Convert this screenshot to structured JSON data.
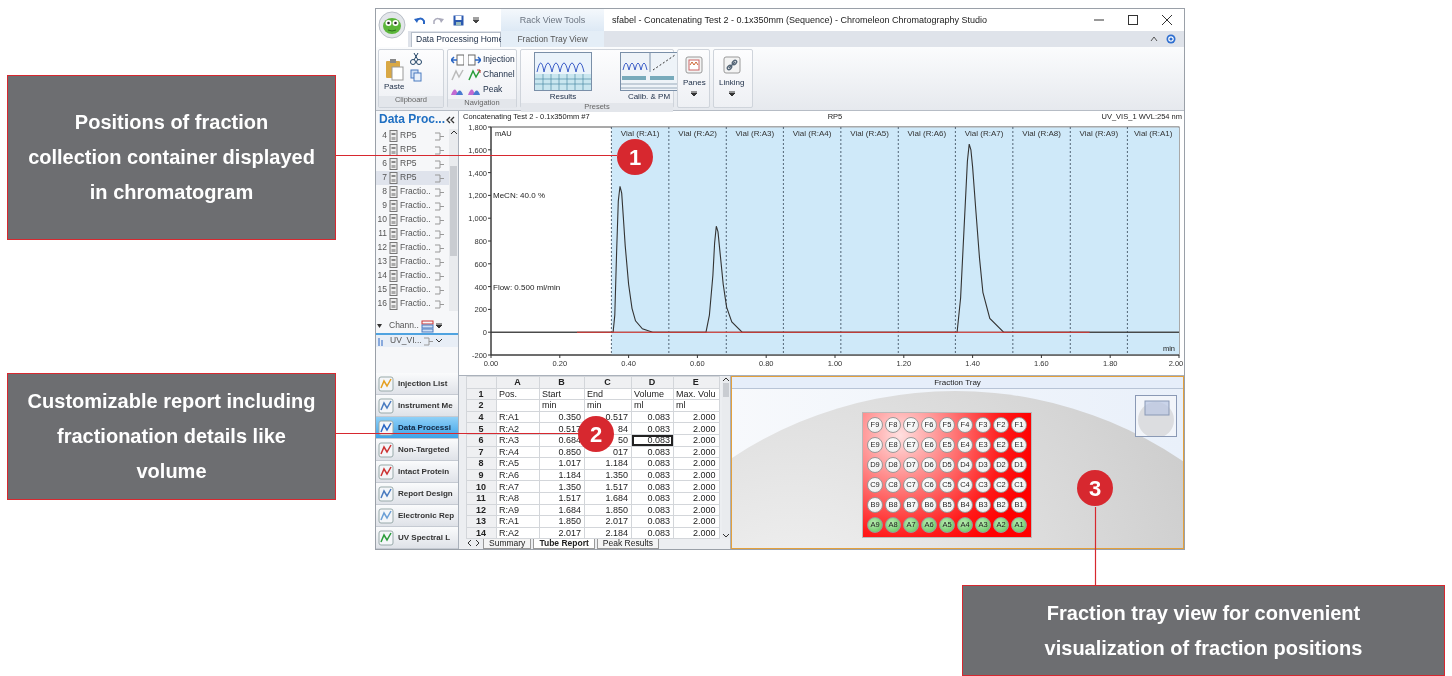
{
  "callouts": [
    {
      "number": "1",
      "text": "Positions of fraction collection container displayed in chromatogram"
    },
    {
      "number": "2",
      "text": "Customizable report including fractionation details like volume"
    },
    {
      "number": "3",
      "text": "Fraction tray view for convenient visualization of fraction positions"
    }
  ],
  "window": {
    "title": "sfabel - Concatenating Test 2 - 0.1x350mm (Sequence) - Chromeleon Chromatography Studio",
    "context_group": "Rack View Tools"
  },
  "tabs": [
    {
      "label": "Data Processing Home",
      "selected": true
    },
    {
      "label": "Fraction Tray View",
      "selected": false
    }
  ],
  "ribbon": [
    {
      "kind": "clipboard",
      "label": "Clipboard",
      "buttons": [
        "Paste"
      ]
    },
    {
      "kind": "navigation",
      "label": "Navigation",
      "buttons": [
        "Injection",
        "Channel",
        "Peak"
      ]
    },
    {
      "kind": "presets",
      "label": "Presets",
      "buttons": [
        "Results",
        "Calib. & PM"
      ]
    },
    {
      "kind": "menu",
      "buttons": [
        "Panes"
      ]
    },
    {
      "kind": "menu",
      "buttons": [
        "Linking"
      ]
    }
  ],
  "navigator": {
    "title": "Data Proc...",
    "items": [
      {
        "number": "4",
        "label": "RP5",
        "selected": false
      },
      {
        "number": "5",
        "label": "RP5",
        "selected": false
      },
      {
        "number": "6",
        "label": "RP5",
        "selected": false
      },
      {
        "number": "7",
        "label": "RP5",
        "selected": true
      },
      {
        "number": "8",
        "label": "Fractio..",
        "selected": false
      },
      {
        "number": "9",
        "label": "Fractio..",
        "selected": false
      },
      {
        "number": "10",
        "label": "Fractio..",
        "selected": false
      },
      {
        "number": "11",
        "label": "Fractio..",
        "selected": false
      },
      {
        "number": "12",
        "label": "Fractio..",
        "selected": false
      },
      {
        "number": "13",
        "label": "Fractio..",
        "selected": false
      },
      {
        "number": "14",
        "label": "Fractio..",
        "selected": false
      },
      {
        "number": "15",
        "label": "Fractio..",
        "selected": false
      },
      {
        "number": "16",
        "label": "Fractio..",
        "selected": false
      }
    ],
    "channel_group": "Chann..",
    "channel": "UV_VI..."
  },
  "modules": [
    {
      "label": "Injection List",
      "selected": false
    },
    {
      "label": "Instrument Me",
      "selected": false
    },
    {
      "label": "Data Processi",
      "selected": true
    },
    {
      "label": "Non-Targeted",
      "selected": false
    },
    {
      "label": "Intact Protein",
      "selected": false
    },
    {
      "label": "Report Design",
      "selected": false
    },
    {
      "label": "Electronic Rep",
      "selected": false
    },
    {
      "label": "UV Spectral L",
      "selected": false
    }
  ],
  "chromatogram": {
    "title": "Concatenating Test 2 - 0.1x350mm #7",
    "center_label": "RP5",
    "signal": "UV_VIS_1 WVL:254 nm",
    "y_unit": "mAU",
    "x_unit": "min",
    "notes": [
      "MeCN: 40.0 %",
      "Flow: 0.500 ml/min"
    ],
    "chart_data": {
      "type": "line",
      "x": [
        0,
        0.25,
        0.34,
        0.355,
        0.36,
        0.365,
        0.37,
        0.375,
        0.38,
        0.385,
        0.39,
        0.4,
        0.41,
        0.42,
        0.44,
        0.47,
        0.6,
        0.625,
        0.635,
        0.645,
        0.65,
        0.655,
        0.66,
        0.665,
        0.675,
        0.685,
        0.7,
        0.73,
        1.34,
        1.355,
        1.365,
        1.375,
        1.385,
        1.39,
        1.395,
        1.4,
        1.41,
        1.42,
        1.43,
        1.45,
        1.49,
        1.74,
        2.0
      ],
      "series": [
        {
          "color": "#333333",
          "values": [
            0,
            0,
            0,
            0,
            150,
            700,
            1150,
            1280,
            1220,
            1000,
            760,
            420,
            210,
            100,
            30,
            0,
            0,
            0,
            150,
            500,
            780,
            930,
            880,
            720,
            420,
            220,
            90,
            0,
            0,
            0,
            300,
            900,
            1500,
            1650,
            1600,
            1450,
            1050,
            650,
            350,
            120,
            0,
            0,
            0
          ]
        },
        {
          "color": "#e53935",
          "values": [
            null,
            0,
            0,
            0,
            0,
            0,
            0,
            0,
            0,
            0,
            0,
            0,
            0,
            0,
            0,
            0,
            0,
            0,
            0,
            0,
            0,
            0,
            0,
            0,
            0,
            0,
            0,
            0,
            0,
            0,
            0,
            0,
            0,
            0,
            0,
            0,
            0,
            0,
            0,
            0,
            0,
            0,
            null
          ]
        }
      ],
      "xlim": [
        0,
        2
      ],
      "ylim": [
        -200,
        1800
      ],
      "xticks": [
        {
          "value": 0,
          "label": "0.00"
        },
        {
          "value": 0.2,
          "label": "0.20"
        },
        {
          "value": 0.4,
          "label": "0.40"
        },
        {
          "value": 0.6,
          "label": "0.60"
        },
        {
          "value": 0.8,
          "label": "0.80"
        },
        {
          "value": 1.0,
          "label": "1.00"
        },
        {
          "value": 1.2,
          "label": "1.20"
        },
        {
          "value": 1.4,
          "label": "1.40"
        },
        {
          "value": 1.6,
          "label": "1.60"
        },
        {
          "value": 1.8,
          "label": "1.80"
        },
        {
          "value": 2.0,
          "label": "2.00"
        }
      ],
      "yticks": [
        {
          "value": -200,
          "label": "-200"
        },
        {
          "value": 0,
          "label": "0"
        },
        {
          "value": 200,
          "label": "200"
        },
        {
          "value": 400,
          "label": "400"
        },
        {
          "value": 600,
          "label": "600"
        },
        {
          "value": 800,
          "label": "800"
        },
        {
          "value": 1000,
          "label": "1,000"
        },
        {
          "value": 1200,
          "label": "1,200"
        },
        {
          "value": 1400,
          "label": "1,400"
        },
        {
          "value": 1600,
          "label": "1,600"
        },
        {
          "value": 1800,
          "label": "1,800"
        }
      ],
      "ref_lines": [
        {
          "axis": "x",
          "value": 0.35,
          "label": "Vial (R:A1)"
        },
        {
          "axis": "x",
          "value": 0.517,
          "label": "Vial (R:A2)"
        },
        {
          "axis": "x",
          "value": 0.684,
          "label": "Vial (R:A3)"
        },
        {
          "axis": "x",
          "value": 0.85,
          "label": "Vial (R:A4)"
        },
        {
          "axis": "x",
          "value": 1.017,
          "label": "Vial (R:A5)"
        },
        {
          "axis": "x",
          "value": 1.184,
          "label": "Vial (R:A6)"
        },
        {
          "axis": "x",
          "value": 1.35,
          "label": "Vial (R:A7)"
        },
        {
          "axis": "x",
          "value": 1.517,
          "label": "Vial (R:A8)"
        },
        {
          "axis": "x",
          "value": 1.684,
          "label": "Vial (R:A9)"
        },
        {
          "axis": "x",
          "value": 1.85,
          "label": "Vial (R:A1)"
        }
      ]
    }
  },
  "report": {
    "columns": [
      "A",
      "B",
      "C",
      "D",
      "E"
    ],
    "rows": [
      {
        "header": "1",
        "kind": "heading",
        "cells": [
          {
            "text": "Pos.",
            "selected": false
          },
          {
            "text": "Start",
            "selected": false
          },
          {
            "text": "End",
            "selected": false
          },
          {
            "text": "Volume",
            "selected": false
          },
          {
            "text": "Max. Volu",
            "selected": false
          }
        ]
      },
      {
        "header": "2",
        "kind": "heading",
        "cells": [
          {
            "selected": false
          },
          {
            "text": "min",
            "selected": false
          },
          {
            "text": "min",
            "selected": false
          },
          {
            "text": "ml",
            "selected": false
          },
          {
            "text": "ml",
            "selected": false
          }
        ]
      },
      {
        "header": "4",
        "kind": "data",
        "cells": [
          {
            "text": "R:A1",
            "selected": false
          },
          {
            "text": "0.350",
            "selected": false
          },
          {
            "text": "0.517",
            "selected": false
          },
          {
            "text": "0.083",
            "selected": false
          },
          {
            "text": "2.000",
            "selected": false
          }
        ]
      },
      {
        "header": "5",
        "kind": "data",
        "cells": [
          {
            "text": "R:A2",
            "selected": false
          },
          {
            "text": "0.517",
            "selected": false
          },
          {
            "text": "84",
            "selected": false
          },
          {
            "text": "0.083",
            "selected": false
          },
          {
            "text": "2.000",
            "selected": false
          }
        ]
      },
      {
        "header": "6",
        "kind": "data",
        "cells": [
          {
            "text": "R:A3",
            "selected": false
          },
          {
            "text": "0.684",
            "selected": false
          },
          {
            "text": "50",
            "selected": false
          },
          {
            "text": "0.083",
            "selected": true
          },
          {
            "text": "2.000",
            "selected": false
          }
        ]
      },
      {
        "header": "7",
        "kind": "data",
        "cells": [
          {
            "text": "R:A4",
            "selected": false
          },
          {
            "text": "0.850",
            "selected": false
          },
          {
            "text": "017",
            "selected": false
          },
          {
            "text": "0.083",
            "selected": false
          },
          {
            "text": "2.000",
            "selected": false
          }
        ]
      },
      {
        "header": "8",
        "kind": "data",
        "cells": [
          {
            "text": "R:A5",
            "selected": false
          },
          {
            "text": "1.017",
            "selected": false
          },
          {
            "text": "1.184",
            "selected": false
          },
          {
            "text": "0.083",
            "selected": false
          },
          {
            "text": "2.000",
            "selected": false
          }
        ]
      },
      {
        "header": "9",
        "kind": "data",
        "cells": [
          {
            "text": "R:A6",
            "selected": false
          },
          {
            "text": "1.184",
            "selected": false
          },
          {
            "text": "1.350",
            "selected": false
          },
          {
            "text": "0.083",
            "selected": false
          },
          {
            "text": "2.000",
            "selected": false
          }
        ]
      },
      {
        "header": "10",
        "kind": "data",
        "cells": [
          {
            "text": "R:A7",
            "selected": false
          },
          {
            "text": "1.350",
            "selected": false
          },
          {
            "text": "1.517",
            "selected": false
          },
          {
            "text": "0.083",
            "selected": false
          },
          {
            "text": "2.000",
            "selected": false
          }
        ]
      },
      {
        "header": "11",
        "kind": "data",
        "cells": [
          {
            "text": "R:A8",
            "selected": false
          },
          {
            "text": "1.517",
            "selected": false
          },
          {
            "text": "1.684",
            "selected": false
          },
          {
            "text": "0.083",
            "selected": false
          },
          {
            "text": "2.000",
            "selected": false
          }
        ]
      },
      {
        "header": "12",
        "kind": "data",
        "cells": [
          {
            "text": "R:A9",
            "selected": false
          },
          {
            "text": "1.684",
            "selected": false
          },
          {
            "text": "1.850",
            "selected": false
          },
          {
            "text": "0.083",
            "selected": false
          },
          {
            "text": "2.000",
            "selected": false
          }
        ]
      },
      {
        "header": "13",
        "kind": "data",
        "cells": [
          {
            "text": "R:A1",
            "selected": false
          },
          {
            "text": "1.850",
            "selected": false
          },
          {
            "text": "2.017",
            "selected": false
          },
          {
            "text": "0.083",
            "selected": false
          },
          {
            "text": "2.000",
            "selected": false
          }
        ]
      },
      {
        "header": "14",
        "kind": "data",
        "cells": [
          {
            "text": "R:A2",
            "selected": false
          },
          {
            "text": "2.017",
            "selected": false
          },
          {
            "text": "2.184",
            "selected": false
          },
          {
            "text": "0.083",
            "selected": false
          },
          {
            "text": "2.000",
            "selected": false
          }
        ]
      }
    ],
    "sheets": [
      {
        "label": "Summary",
        "selected": false
      },
      {
        "label": "Tube Report",
        "selected": true
      },
      {
        "label": "Peak Results",
        "selected": false
      }
    ]
  },
  "tray": {
    "title": "Fraction Tray",
    "rows": [
      {
        "wells": [
          {
            "label": "F9",
            "filled": false
          },
          {
            "label": "F8",
            "filled": false
          },
          {
            "label": "F7",
            "filled": false
          },
          {
            "label": "F6",
            "filled": false
          },
          {
            "label": "F5",
            "filled": false
          },
          {
            "label": "F4",
            "filled": false
          },
          {
            "label": "F3",
            "filled": false
          },
          {
            "label": "F2",
            "filled": false
          },
          {
            "label": "F1",
            "filled": false
          }
        ]
      },
      {
        "wells": [
          {
            "label": "E9",
            "filled": false
          },
          {
            "label": "E8",
            "filled": false
          },
          {
            "label": "E7",
            "filled": false
          },
          {
            "label": "E6",
            "filled": false
          },
          {
            "label": "E5",
            "filled": false
          },
          {
            "label": "E4",
            "filled": false
          },
          {
            "label": "E3",
            "filled": false
          },
          {
            "label": "E2",
            "filled": false
          },
          {
            "label": "E1",
            "filled": false
          }
        ]
      },
      {
        "wells": [
          {
            "label": "D9",
            "filled": false
          },
          {
            "label": "D8",
            "filled": false
          },
          {
            "label": "D7",
            "filled": false
          },
          {
            "label": "D6",
            "filled": false
          },
          {
            "label": "D5",
            "filled": false
          },
          {
            "label": "D4",
            "filled": false
          },
          {
            "label": "D3",
            "filled": false
          },
          {
            "label": "D2",
            "filled": false
          },
          {
            "label": "D1",
            "filled": false
          }
        ]
      },
      {
        "wells": [
          {
            "label": "C9",
            "filled": false
          },
          {
            "label": "C8",
            "filled": false
          },
          {
            "label": "C7",
            "filled": false
          },
          {
            "label": "C6",
            "filled": false
          },
          {
            "label": "C5",
            "filled": false
          },
          {
            "label": "C4",
            "filled": false
          },
          {
            "label": "C3",
            "filled": false
          },
          {
            "label": "C2",
            "filled": false
          },
          {
            "label": "C1",
            "filled": false
          }
        ]
      },
      {
        "wells": [
          {
            "label": "B9",
            "filled": false
          },
          {
            "label": "B8",
            "filled": false
          },
          {
            "label": "B7",
            "filled": false
          },
          {
            "label": "B6",
            "filled": false
          },
          {
            "label": "B5",
            "filled": false
          },
          {
            "label": "B4",
            "filled": false
          },
          {
            "label": "B3",
            "filled": false
          },
          {
            "label": "B2",
            "filled": false
          },
          {
            "label": "B1",
            "filled": false
          }
        ]
      },
      {
        "wells": [
          {
            "label": "A9",
            "filled": true
          },
          {
            "label": "A8",
            "filled": true
          },
          {
            "label": "A7",
            "filled": true
          },
          {
            "label": "A6",
            "filled": true
          },
          {
            "label": "A5",
            "filled": true
          },
          {
            "label": "A4",
            "filled": true
          },
          {
            "label": "A3",
            "filled": true
          },
          {
            "label": "A2",
            "filled": true
          },
          {
            "label": "A1",
            "filled": true
          }
        ]
      }
    ]
  }
}
